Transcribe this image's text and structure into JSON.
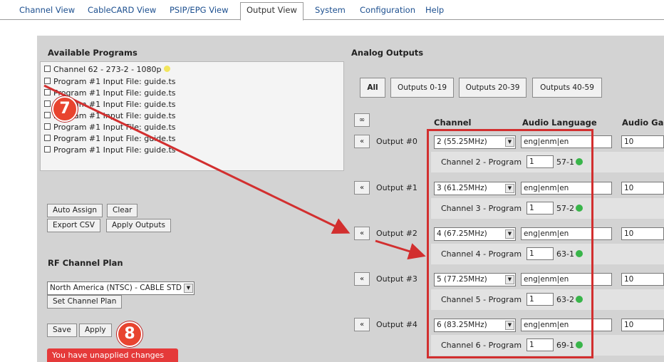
{
  "tabs": [
    {
      "label": "Channel View"
    },
    {
      "label": "CableCARD View"
    },
    {
      "label": "PSIP/EPG View"
    },
    {
      "label": "Output View"
    },
    {
      "label": "System"
    },
    {
      "label": "Configuration"
    },
    {
      "label": "Help"
    }
  ],
  "active_tab": "Output View",
  "available_programs": {
    "heading": "Available Programs",
    "items": [
      {
        "label": "Channel 62 - 273-2 - 1080p"
      },
      {
        "label": "Program #1 Input File: guide.ts"
      },
      {
        "label": "Program #1 Input File: guide.ts"
      },
      {
        "label": "Program #1 Input File: guide.ts"
      },
      {
        "label": "Program #1 Input File: guide.ts"
      },
      {
        "label": "Program #1 Input File: guide.ts"
      },
      {
        "label": "Program #1 Input File: guide.ts"
      },
      {
        "label": "Program #1 Input File: guide.ts"
      }
    ]
  },
  "actions": {
    "auto_assign": "Auto Assign",
    "clear": "Clear",
    "export_csv": "Export CSV",
    "apply_outputs": "Apply Outputs"
  },
  "rf_plan": {
    "heading": "RF Channel Plan",
    "selected": "North America (NTSC) - CABLE STD",
    "set_button": "Set Channel Plan"
  },
  "footer": {
    "save": "Save",
    "apply": "Apply",
    "warning": "You have unapplied changes"
  },
  "analog_outputs": {
    "heading": "Analog Outputs",
    "range_buttons": [
      "All",
      "Outputs 0-19",
      "Outputs 20-39",
      "Outputs 40-59"
    ],
    "expand_label": "∞",
    "columns": [
      "Channel",
      "Audio Language",
      "Audio Gai"
    ],
    "rows": [
      {
        "label": "Output #0",
        "channel": "2 (55.25MHz)",
        "audio_lang": "eng|enm|en",
        "gain": "10",
        "program_label": "Channel 2 - Program",
        "program_num": "1",
        "virtual": "57-1"
      },
      {
        "label": "Output #1",
        "channel": "3 (61.25MHz)",
        "audio_lang": "eng|enm|en",
        "gain": "10",
        "program_label": "Channel 3 - Program",
        "program_num": "1",
        "virtual": "57-2"
      },
      {
        "label": "Output #2",
        "channel": "4 (67.25MHz)",
        "audio_lang": "eng|enm|en",
        "gain": "10",
        "program_label": "Channel 4 - Program",
        "program_num": "1",
        "virtual": "63-1"
      },
      {
        "label": "Output #3",
        "channel": "5 (77.25MHz)",
        "audio_lang": "eng|enm|en",
        "gain": "10",
        "program_label": "Channel 5 - Program",
        "program_num": "1",
        "virtual": "63-2"
      },
      {
        "label": "Output #4",
        "channel": "6 (83.25MHz)",
        "audio_lang": "eng|enm|en",
        "gain": "10",
        "program_label": "Channel 6 - Program",
        "program_num": "1",
        "virtual": "69-1"
      }
    ]
  },
  "callouts": [
    {
      "number": "7"
    },
    {
      "number": "8"
    }
  ],
  "colors": {
    "tab_link": "#1c4f8f",
    "panel_bg": "#d3d3d3",
    "highlight_red": "#d22f2f",
    "warning_bg": "#e53a3a",
    "status_green": "#39b54a",
    "status_yellow": "#f2e55c"
  }
}
